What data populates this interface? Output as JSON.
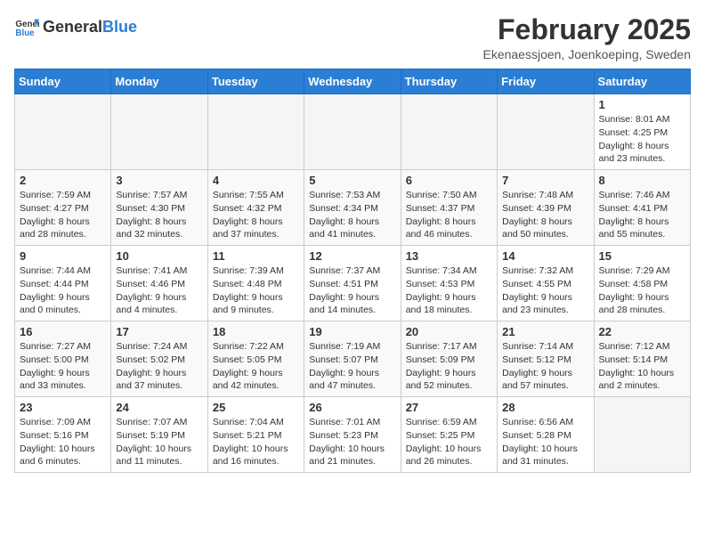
{
  "logo": {
    "text_general": "General",
    "text_blue": "Blue"
  },
  "title": "February 2025",
  "subtitle": "Ekenaessjoen, Joenkoeping, Sweden",
  "days_of_week": [
    "Sunday",
    "Monday",
    "Tuesday",
    "Wednesday",
    "Thursday",
    "Friday",
    "Saturday"
  ],
  "weeks": [
    [
      {
        "day": "",
        "detail": ""
      },
      {
        "day": "",
        "detail": ""
      },
      {
        "day": "",
        "detail": ""
      },
      {
        "day": "",
        "detail": ""
      },
      {
        "day": "",
        "detail": ""
      },
      {
        "day": "",
        "detail": ""
      },
      {
        "day": "1",
        "detail": "Sunrise: 8:01 AM\nSunset: 4:25 PM\nDaylight: 8 hours and 23 minutes."
      }
    ],
    [
      {
        "day": "2",
        "detail": "Sunrise: 7:59 AM\nSunset: 4:27 PM\nDaylight: 8 hours and 28 minutes."
      },
      {
        "day": "3",
        "detail": "Sunrise: 7:57 AM\nSunset: 4:30 PM\nDaylight: 8 hours and 32 minutes."
      },
      {
        "day": "4",
        "detail": "Sunrise: 7:55 AM\nSunset: 4:32 PM\nDaylight: 8 hours and 37 minutes."
      },
      {
        "day": "5",
        "detail": "Sunrise: 7:53 AM\nSunset: 4:34 PM\nDaylight: 8 hours and 41 minutes."
      },
      {
        "day": "6",
        "detail": "Sunrise: 7:50 AM\nSunset: 4:37 PM\nDaylight: 8 hours and 46 minutes."
      },
      {
        "day": "7",
        "detail": "Sunrise: 7:48 AM\nSunset: 4:39 PM\nDaylight: 8 hours and 50 minutes."
      },
      {
        "day": "8",
        "detail": "Sunrise: 7:46 AM\nSunset: 4:41 PM\nDaylight: 8 hours and 55 minutes."
      }
    ],
    [
      {
        "day": "9",
        "detail": "Sunrise: 7:44 AM\nSunset: 4:44 PM\nDaylight: 9 hours and 0 minutes."
      },
      {
        "day": "10",
        "detail": "Sunrise: 7:41 AM\nSunset: 4:46 PM\nDaylight: 9 hours and 4 minutes."
      },
      {
        "day": "11",
        "detail": "Sunrise: 7:39 AM\nSunset: 4:48 PM\nDaylight: 9 hours and 9 minutes."
      },
      {
        "day": "12",
        "detail": "Sunrise: 7:37 AM\nSunset: 4:51 PM\nDaylight: 9 hours and 14 minutes."
      },
      {
        "day": "13",
        "detail": "Sunrise: 7:34 AM\nSunset: 4:53 PM\nDaylight: 9 hours and 18 minutes."
      },
      {
        "day": "14",
        "detail": "Sunrise: 7:32 AM\nSunset: 4:55 PM\nDaylight: 9 hours and 23 minutes."
      },
      {
        "day": "15",
        "detail": "Sunrise: 7:29 AM\nSunset: 4:58 PM\nDaylight: 9 hours and 28 minutes."
      }
    ],
    [
      {
        "day": "16",
        "detail": "Sunrise: 7:27 AM\nSunset: 5:00 PM\nDaylight: 9 hours and 33 minutes."
      },
      {
        "day": "17",
        "detail": "Sunrise: 7:24 AM\nSunset: 5:02 PM\nDaylight: 9 hours and 37 minutes."
      },
      {
        "day": "18",
        "detail": "Sunrise: 7:22 AM\nSunset: 5:05 PM\nDaylight: 9 hours and 42 minutes."
      },
      {
        "day": "19",
        "detail": "Sunrise: 7:19 AM\nSunset: 5:07 PM\nDaylight: 9 hours and 47 minutes."
      },
      {
        "day": "20",
        "detail": "Sunrise: 7:17 AM\nSunset: 5:09 PM\nDaylight: 9 hours and 52 minutes."
      },
      {
        "day": "21",
        "detail": "Sunrise: 7:14 AM\nSunset: 5:12 PM\nDaylight: 9 hours and 57 minutes."
      },
      {
        "day": "22",
        "detail": "Sunrise: 7:12 AM\nSunset: 5:14 PM\nDaylight: 10 hours and 2 minutes."
      }
    ],
    [
      {
        "day": "23",
        "detail": "Sunrise: 7:09 AM\nSunset: 5:16 PM\nDaylight: 10 hours and 6 minutes."
      },
      {
        "day": "24",
        "detail": "Sunrise: 7:07 AM\nSunset: 5:19 PM\nDaylight: 10 hours and 11 minutes."
      },
      {
        "day": "25",
        "detail": "Sunrise: 7:04 AM\nSunset: 5:21 PM\nDaylight: 10 hours and 16 minutes."
      },
      {
        "day": "26",
        "detail": "Sunrise: 7:01 AM\nSunset: 5:23 PM\nDaylight: 10 hours and 21 minutes."
      },
      {
        "day": "27",
        "detail": "Sunrise: 6:59 AM\nSunset: 5:25 PM\nDaylight: 10 hours and 26 minutes."
      },
      {
        "day": "28",
        "detail": "Sunrise: 6:56 AM\nSunset: 5:28 PM\nDaylight: 10 hours and 31 minutes."
      },
      {
        "day": "",
        "detail": ""
      }
    ]
  ]
}
